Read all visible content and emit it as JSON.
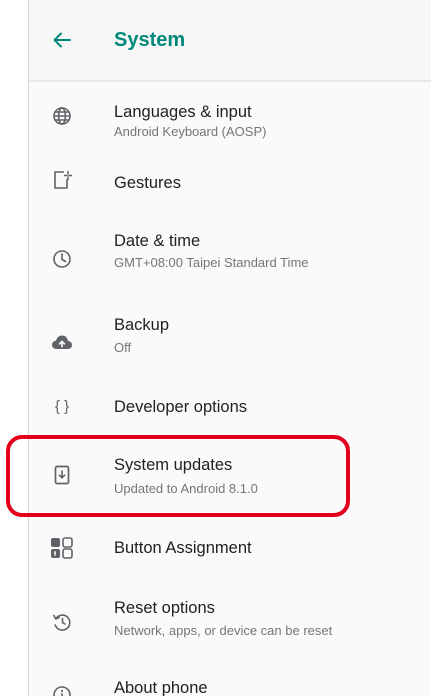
{
  "header": {
    "title": "System",
    "back_icon": "arrow-back-icon",
    "accent_color": "#00897b"
  },
  "items": [
    {
      "title": "Languages & input",
      "subtitle": "Android Keyboard (AOSP)",
      "icon": "globe-icon"
    },
    {
      "title": "Gestures",
      "subtitle": "",
      "icon": "gestures-icon"
    },
    {
      "title": "Date & time",
      "subtitle": "GMT+08:00 Taipei Standard Time",
      "icon": "clock-icon"
    },
    {
      "title": "Backup",
      "subtitle": "Off",
      "icon": "cloud-upload-icon"
    },
    {
      "title": "Developer options",
      "subtitle": "",
      "icon": "braces-icon"
    },
    {
      "title": "System updates",
      "subtitle": "Updated to Android 8.1.0",
      "icon": "system-update-icon"
    },
    {
      "title": "Button Assignment",
      "subtitle": "",
      "icon": "button-assignment-icon"
    },
    {
      "title": "Reset options",
      "subtitle": "Network, apps, or device can be reset",
      "icon": "restore-icon"
    },
    {
      "title": "About phone",
      "subtitle": "",
      "icon": "info-icon"
    }
  ],
  "annotation": {
    "highlight_color": "#e2001a",
    "highlighted_item": "System updates"
  }
}
